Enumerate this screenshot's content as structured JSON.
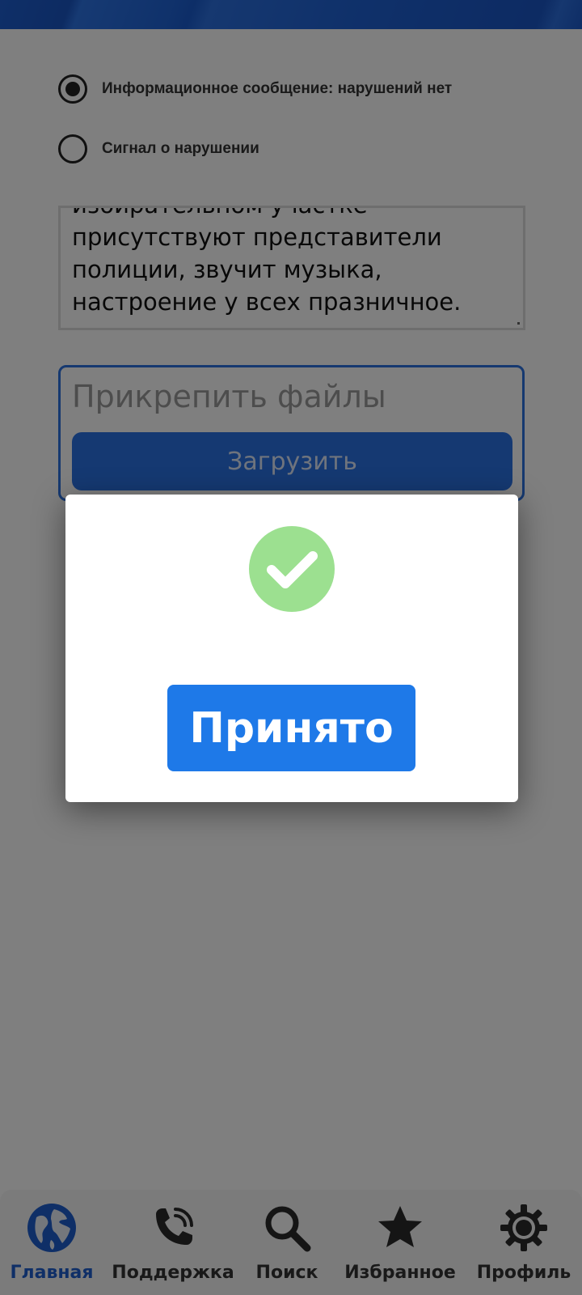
{
  "form": {
    "radio_options": [
      {
        "label": "Информационное сообщение: нарушений нет",
        "selected": true
      },
      {
        "label": "Сигнал о нарушении",
        "selected": false
      }
    ],
    "description_lines": [
      "избирательном участке",
      "присутствуют представители",
      "полиции, звучит музыка,",
      "настроение у всех празничное."
    ],
    "attach_title": "Прикрепить файлы",
    "upload_label": "Загрузить"
  },
  "dialog": {
    "icon": "check-circle-icon",
    "icon_color": "#9ce090",
    "button_label": "Принято",
    "button_color": "#1e79e8"
  },
  "bottom_nav": {
    "items": [
      {
        "label": "Главная",
        "icon": "globe-icon",
        "active": true
      },
      {
        "label": "Поддержка",
        "icon": "phone-icon",
        "active": false
      },
      {
        "label": "Поиск",
        "icon": "search-icon",
        "active": false
      },
      {
        "label": "Избранное",
        "icon": "star-icon",
        "active": false
      },
      {
        "label": "Профиль",
        "icon": "gear-icon",
        "active": false
      }
    ],
    "active_color": "#1f5fcf"
  }
}
